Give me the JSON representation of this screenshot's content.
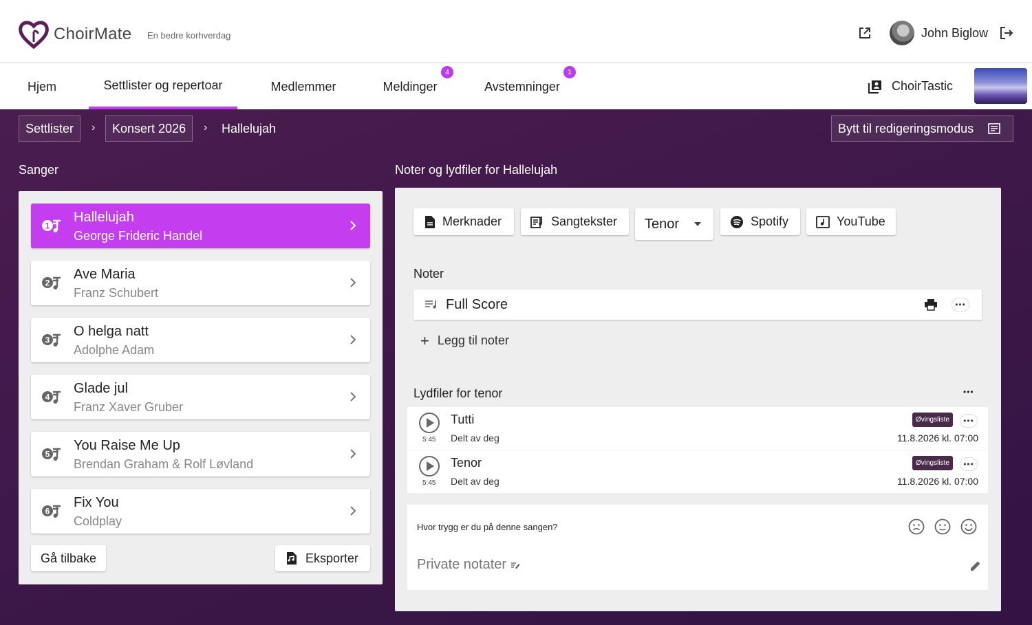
{
  "header": {
    "app_name": "ChoirMate",
    "tagline": "En bedre korhverdag",
    "user_name": "John Biglow"
  },
  "nav": {
    "items": [
      {
        "label": "Hjem"
      },
      {
        "label": "Settlister og repertoar",
        "active": true
      },
      {
        "label": "Medlemmer"
      },
      {
        "label": "Meldinger",
        "badge": "4"
      },
      {
        "label": "Avstemninger",
        "badge": "1"
      }
    ],
    "choir_name": "ChoirTastic"
  },
  "breadcrumb": {
    "items": [
      "Settlister",
      "Konsert 2026"
    ],
    "current": "Hallelujah",
    "edit_mode_label": "Bytt til redigeringsmodus"
  },
  "songs": {
    "title": "Sanger",
    "items": [
      {
        "number": "1",
        "title": "Hallelujah",
        "composer": "George Frideric Handel",
        "active": true
      },
      {
        "number": "2",
        "title": "Ave Maria",
        "composer": "Franz Schubert"
      },
      {
        "number": "3",
        "title": "O helga natt",
        "composer": "Adolphe Adam"
      },
      {
        "number": "4",
        "title": "Glade jul",
        "composer": "Franz Xaver Gruber"
      },
      {
        "number": "5",
        "title": "You Raise Me Up",
        "composer": "Brendan Graham & Rolf Løvland"
      },
      {
        "number": "6",
        "title": "Fix You",
        "composer": "Coldplay"
      }
    ],
    "back_label": "Gå tilbake",
    "export_label": "Eksporter"
  },
  "details": {
    "title": "Noter og lydfiler for Hallelujah",
    "tools": {
      "notes": "Merknader",
      "lyrics": "Sangtekster",
      "voice": "Tenor",
      "spotify": "Spotify",
      "youtube": "YouTube"
    },
    "sheets_title": "Noter",
    "sheets": [
      {
        "name": "Full Score"
      }
    ],
    "add_sheet": "Legg til noter",
    "audio_title": "Lydfiler for tenor",
    "audio": [
      {
        "name": "Tutti",
        "duration": "5:45",
        "shared": "Delt av deg",
        "tag": "Øvingsliste",
        "date": "11.8.2026 kl. 07:00"
      },
      {
        "name": "Tenor",
        "duration": "5:45",
        "shared": "Delt av deg",
        "tag": "Øvingsliste",
        "date": "11.8.2026 kl. 07:00"
      }
    ],
    "confidence_question": "Hvor trygg er du på denne sangen?",
    "private_notes_placeholder": "Private notater"
  },
  "colors": {
    "accent": "#c43def",
    "badge": "#b93ee9",
    "background": "#3d1848"
  }
}
